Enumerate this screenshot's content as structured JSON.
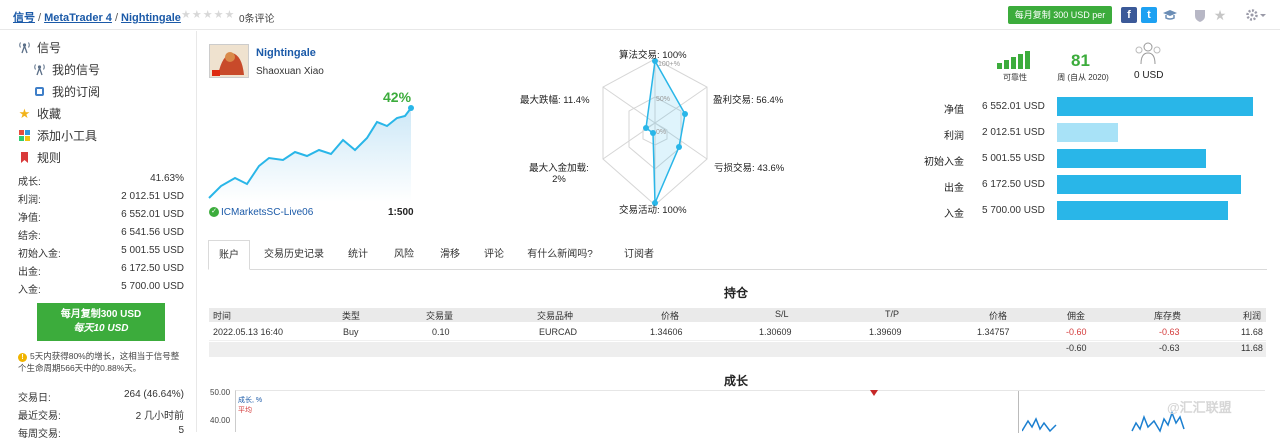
{
  "breadcrumb": {
    "signals": "信号",
    "platform": "MetaTrader 4",
    "name": "Nightingale",
    "separator": "/"
  },
  "rating": {
    "stars": "★★★★★",
    "reviews": "0条评论"
  },
  "header": {
    "copy_label": "每月复制 300 USD per"
  },
  "sidebar": {
    "items": [
      {
        "label": "信号",
        "icon": "antenna-icon"
      },
      {
        "label": "我的信号",
        "icon": "antenna-icon"
      },
      {
        "label": "我的订阅",
        "icon": "subscription-icon"
      },
      {
        "label": "收藏",
        "icon": "star-icon"
      },
      {
        "label": "添加小工具",
        "icon": "widgets-icon"
      },
      {
        "label": "规则",
        "icon": "bookmark-icon"
      }
    ],
    "stats": [
      {
        "label": "成长:",
        "value": "41.63%"
      },
      {
        "label": "利润:",
        "value": "2 012.51 USD"
      },
      {
        "label": "净值:",
        "value": "6 552.01 USD"
      },
      {
        "label": "结余:",
        "value": "6 541.56 USD"
      },
      {
        "label": "初始入金:",
        "value": "5 001.55 USD"
      },
      {
        "label": "出金:",
        "value": "6 172.50 USD"
      },
      {
        "label": "入金:",
        "value": "5 700.00 USD"
      }
    ],
    "copy_button": {
      "line1": "每月复制300 USD",
      "line2": "每天10 USD"
    },
    "note": "5天内获得80%的增长，这相当于信号整个生命周期566天中的0.88%天。",
    "stats2": [
      {
        "label": "交易日:",
        "value": "264 (46.64%)"
      },
      {
        "label": "最近交易:",
        "value": "2 几小时前"
      },
      {
        "label": "每周交易:",
        "value": "5"
      }
    ]
  },
  "provider": {
    "name": "Nightingale",
    "author": "Shaoxuan Xiao",
    "growth": "42%",
    "server": "ICMarketsSC-Live06",
    "leverage": "1:500"
  },
  "radar": {
    "algo": "算法交易: 100%",
    "profit_trades": "盈利交易: 56.4%",
    "loss_trades": "亏损交易: 43.6%",
    "activity": "交易活动: 100%",
    "max_deposit_load_1": "最大入金加载:",
    "max_deposit_load_2": "2%",
    "max_drawdown": "最大跌幅: 11.4%",
    "ticks": [
      "100+%",
      "50%",
      "0%"
    ]
  },
  "summary": {
    "reliability_label": "可靠性",
    "weeks_value": "81",
    "weeks_label": "周 (自从 2020)",
    "subscribers_value": "0 USD"
  },
  "bars": [
    {
      "label": "净值",
      "value": "6 552.01 USD",
      "fill": 1.0,
      "color": "#29b6e8"
    },
    {
      "label": "利润",
      "value": "2 012.51 USD",
      "fill": 0.31,
      "color": "#a8e2f7"
    },
    {
      "label": "初始入金",
      "value": "5 001.55 USD",
      "fill": 0.76,
      "color": "#29b6e8"
    },
    {
      "label": "出金",
      "value": "6 172.50 USD",
      "fill": 0.94,
      "color": "#29b6e8"
    },
    {
      "label": "入金",
      "value": "5 700.00 USD",
      "fill": 0.87,
      "color": "#29b6e8"
    }
  ],
  "tabs": [
    "账户",
    "交易历史记录",
    "统计",
    "风险",
    "滑移",
    "评论",
    "有什么新闻吗?",
    "订阅者"
  ],
  "positions": {
    "title": "持仓",
    "headers": [
      "时间",
      "类型",
      "交易量",
      "交易品种",
      "价格",
      "S/L",
      "T/P",
      "价格",
      "佣金",
      "库存费",
      "利润"
    ],
    "row": [
      "2022.05.13 16:40",
      "Buy",
      "0.10",
      "EURCAD",
      "1.34606",
      "1.30609",
      "1.39609",
      "1.34757",
      "-0.60",
      "-0.63",
      "11.68"
    ],
    "totals": [
      "-0.60",
      "-0.63",
      "11.68"
    ]
  },
  "growth_chart": {
    "title": "成长",
    "legend_growth": "成长, %",
    "legend_avg": "平均",
    "y_ticks": [
      "50.00",
      "40.00"
    ]
  },
  "watermark": "@汇汇联盟"
}
